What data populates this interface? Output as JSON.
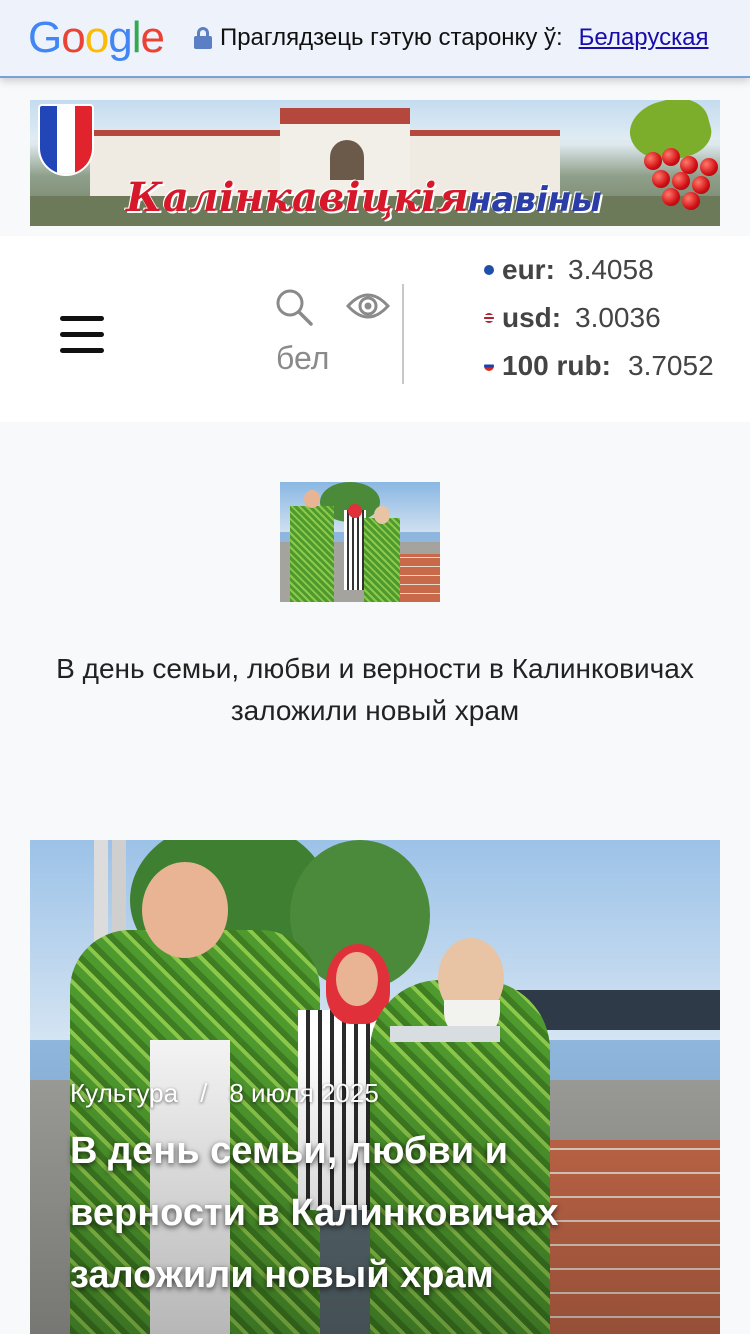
{
  "translate_bar": {
    "logo": "Google",
    "prompt": "Праглядзець гэтую старонку ў:",
    "language_link": "Беларуская"
  },
  "banner": {
    "title_part1": "Калінкавіцкія",
    "title_part2": "навіны"
  },
  "header": {
    "menu_icon": "hamburger-icon",
    "search_icon": "search-icon",
    "accessibility_icon": "eye-icon",
    "language_label": "бел",
    "rates": [
      {
        "currency": "eur:",
        "value": "3.4058",
        "flag_color": "#1f4fa8"
      },
      {
        "currency": "usd:",
        "value": "3.0036",
        "flag_color": "#b22234"
      },
      {
        "currency": "100 rub:",
        "value": "3.7052",
        "flag_color": "#d52b1e"
      }
    ]
  },
  "featured": {
    "caption": "В день семьи, любви и верности в Калинковичах заложили новый храм"
  },
  "article": {
    "category": "Культура",
    "separator": "/",
    "date": "8 июля 2025",
    "headline": "В день семьи, любви и верности в Калинковичах заложили новый храм"
  },
  "colors": {
    "link": "#1a0dab",
    "banner_title_red": "#d6182a",
    "banner_title_blue": "#2b3ea8"
  }
}
